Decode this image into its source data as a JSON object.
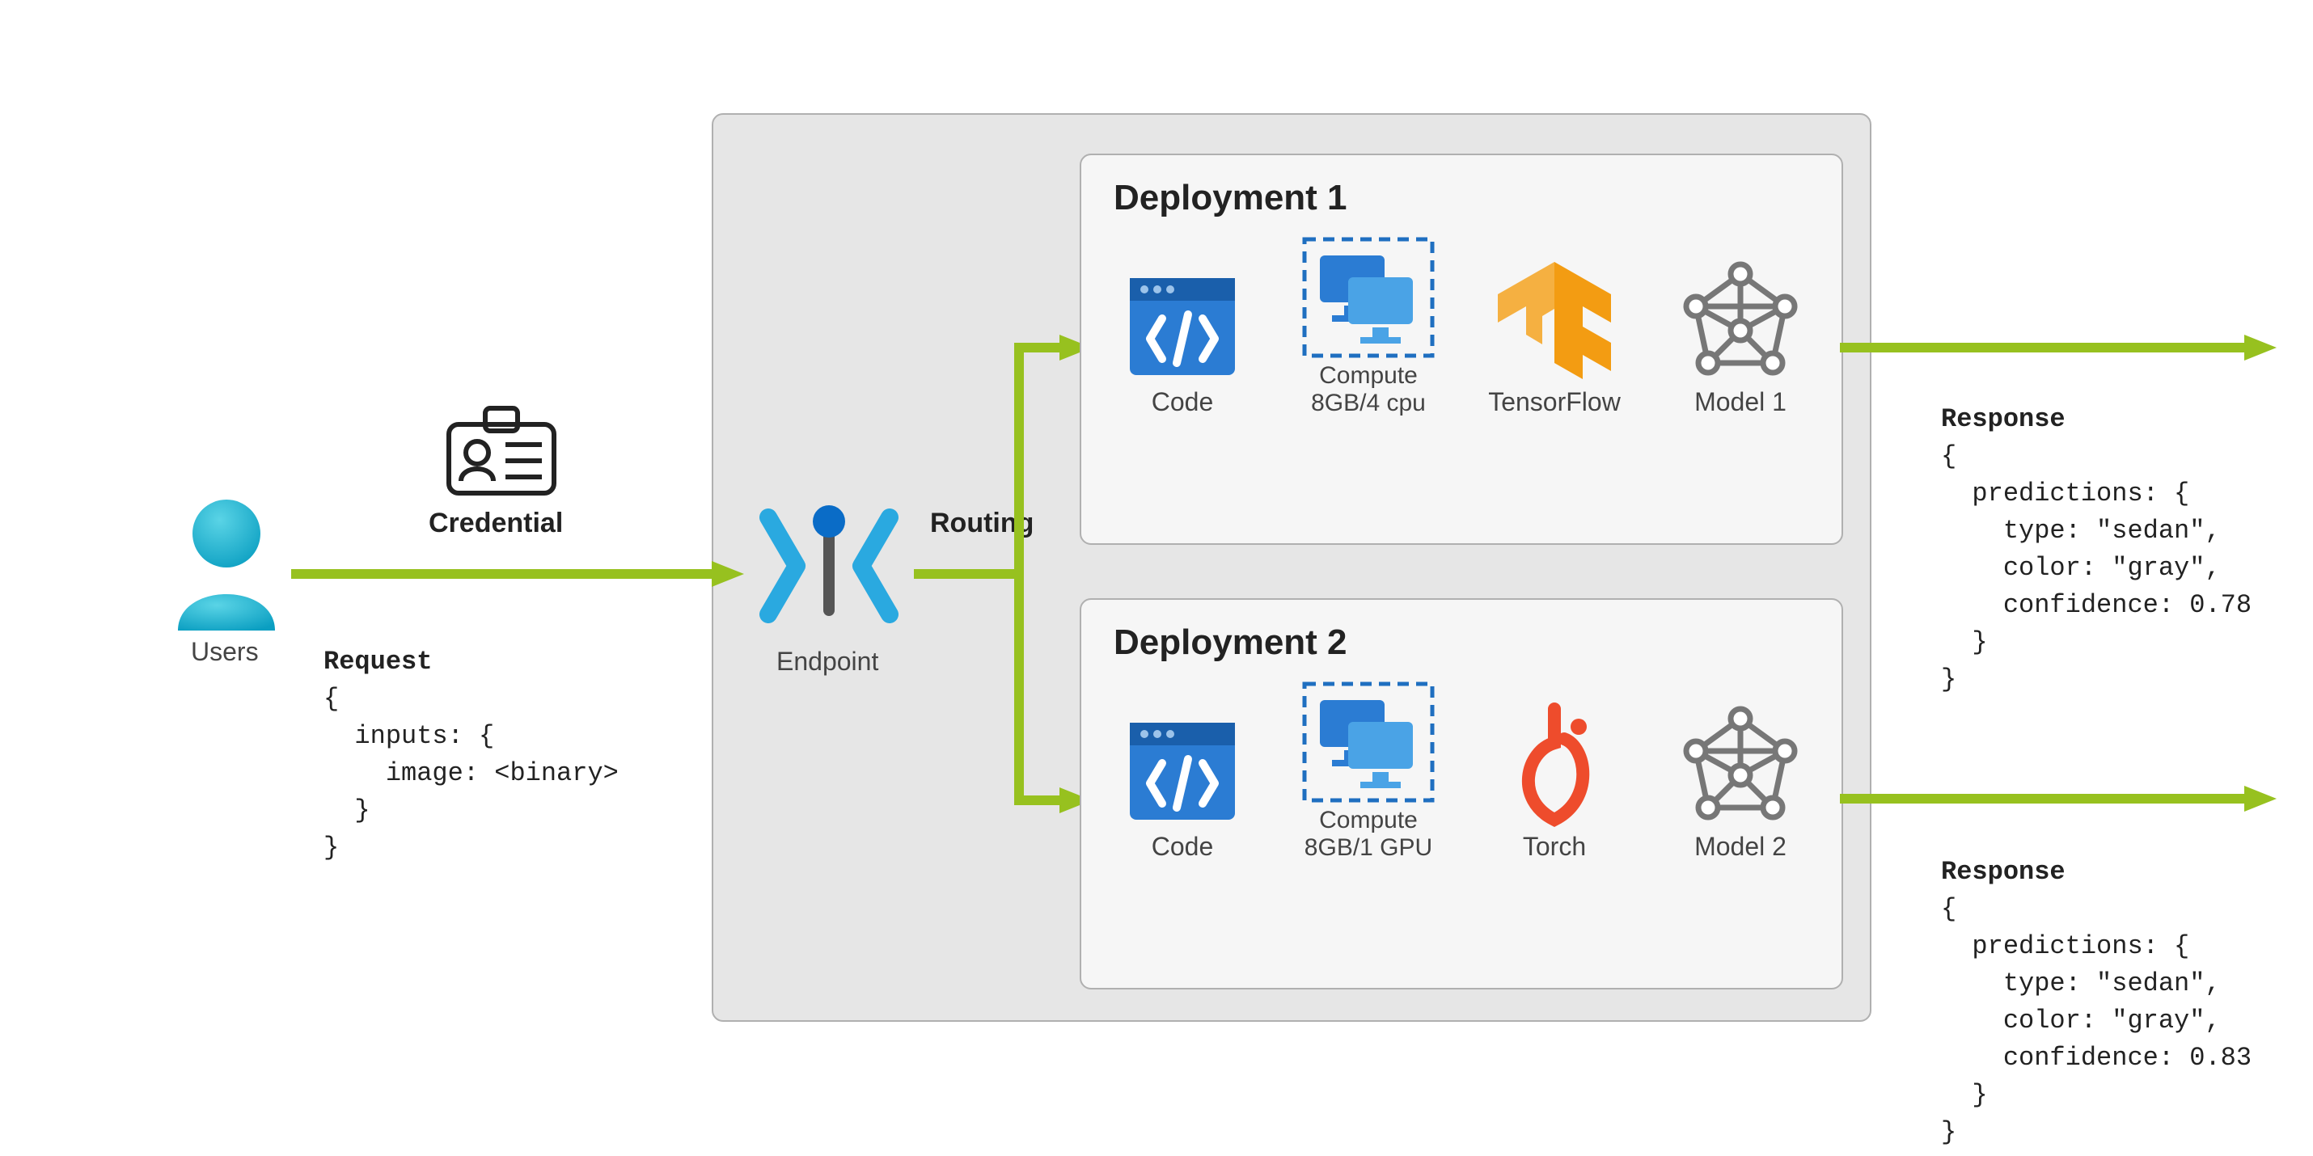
{
  "users_label": "Users",
  "credential_label": "Credential",
  "request": {
    "title": "Request",
    "line1": "{",
    "line2": "  inputs: {",
    "line3": "    image: <binary>",
    "line4": "  }",
    "line5": "}"
  },
  "endpoint_label": "Endpoint",
  "routing_label": "Routing",
  "deployments": {
    "d1": {
      "title": "Deployment 1",
      "code": "Code",
      "compute_label": "Compute",
      "compute_spec": "8GB/4 cpu",
      "framework": "TensorFlow",
      "model": "Model 1"
    },
    "d2": {
      "title": "Deployment 2",
      "code": "Code",
      "compute_label": "Compute",
      "compute_spec": "8GB/1 GPU",
      "framework": "Torch",
      "model": "Model 2"
    }
  },
  "response1": {
    "title": "Response",
    "line1": "{",
    "line2": "  predictions: {",
    "line3": "    type: \"sedan\",",
    "line4": "    color: \"gray\",",
    "line5": "    confidence: 0.78",
    "line6": "  }",
    "line7": "}"
  },
  "response2": {
    "title": "Response",
    "line1": "{",
    "line2": "  predictions: {",
    "line3": "    type: \"sedan\",",
    "line4": "    color: \"gray\",",
    "line5": "    confidence: 0.83",
    "line6": "  }",
    "line7": "}"
  }
}
